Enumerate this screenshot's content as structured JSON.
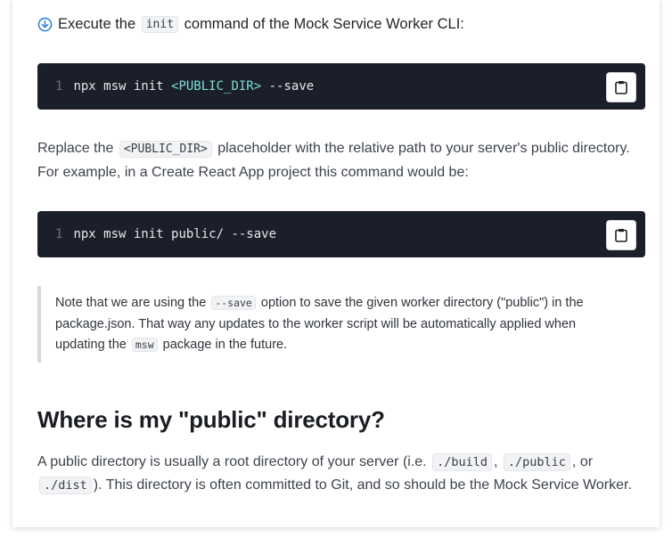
{
  "step": {
    "prefix": "Execute the",
    "code": "init",
    "suffix": "command of the Mock Service Worker CLI:"
  },
  "code_blocks": [
    {
      "line": "1",
      "cmd": "npx msw init ",
      "placeholder": "<PUBLIC_DIR>",
      "rest": " --save"
    },
    {
      "line": "1",
      "cmd": "npx msw init public/ --save",
      "placeholder": "",
      "rest": ""
    }
  ],
  "paragraph1": {
    "a": "Replace the",
    "code": "<PUBLIC_DIR>",
    "b": "placeholder with the relative path to your server's public directory. For example, in a Create React App project this command would be:"
  },
  "note": {
    "a": "Note that we are using the",
    "code1": "--save",
    "b": "option to save the given worker directory (\"public\") in the package.json. That way any updates to the worker script will be automatically applied when updating the",
    "code2": "msw",
    "c": "package in the future."
  },
  "heading": "Where is my \"public\" directory?",
  "paragraph2": {
    "a": "A public directory is usually a root directory of your server (i.e.",
    "code1": "./build",
    "sep1": ",",
    "code2": "./public",
    "sep2": ", or",
    "code3": "./dist",
    "b": "). This directory is often committed to Git, and so should be the Mock Service Worker."
  }
}
